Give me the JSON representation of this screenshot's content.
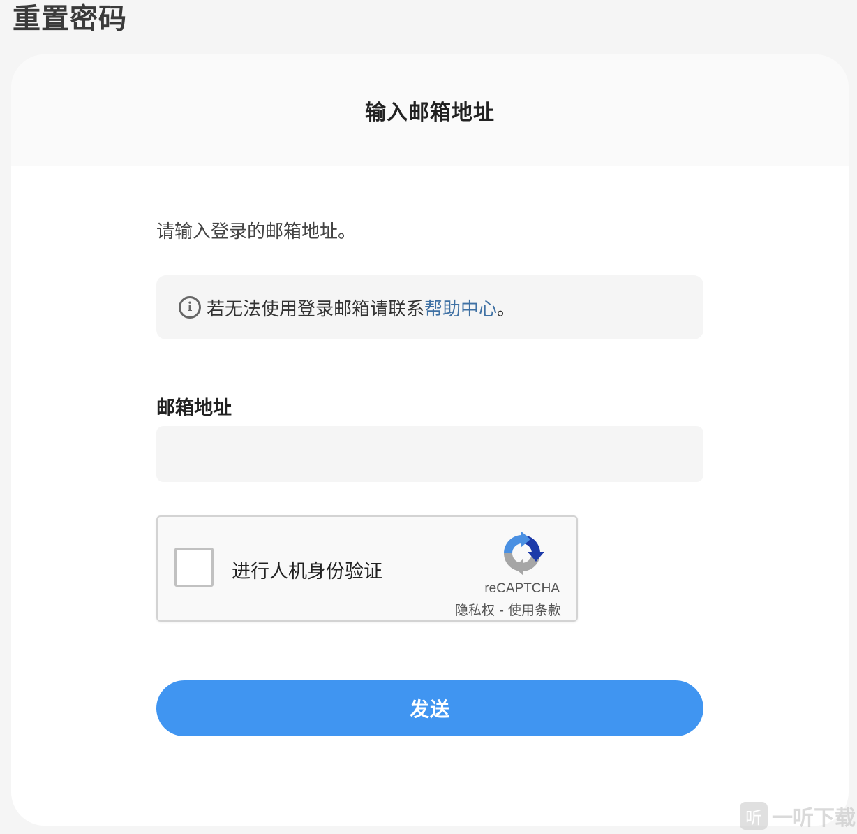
{
  "page": {
    "title": "重置密码"
  },
  "card": {
    "header_title": "输入邮箱地址",
    "instruction": "请输入登录的邮箱地址。",
    "notice": {
      "icon": "info-icon",
      "text": "若无法使用登录邮箱请联系",
      "link_label": "帮助中心",
      "suffix": "。"
    },
    "email": {
      "label": "邮箱地址",
      "value": "",
      "placeholder": ""
    },
    "recaptcha": {
      "label": "进行人机身份验证",
      "brand": "reCAPTCHA",
      "privacy_label": "隐私权",
      "separator": " - ",
      "terms_label": "使用条款"
    },
    "submit_label": "发送"
  },
  "watermark": {
    "badge": "听",
    "text": "一听下载"
  },
  "colors": {
    "accent": "#4095f1",
    "link": "#3f71a4",
    "background": "#f5f5f5"
  }
}
